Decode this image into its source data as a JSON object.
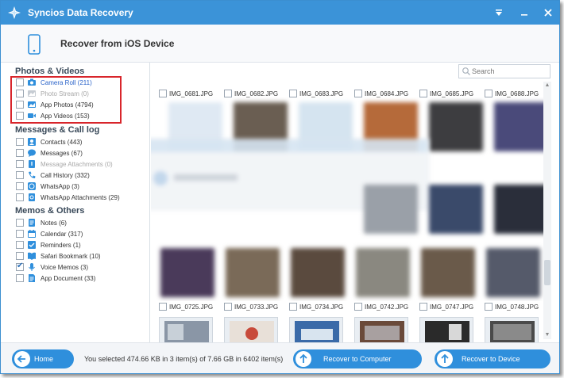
{
  "window": {
    "title": "Syncios Data Recovery",
    "controls": [
      "menu-icon",
      "minimize-icon",
      "close-icon"
    ]
  },
  "header": {
    "title": "Recover from iOS Device",
    "icon": "phone-icon"
  },
  "sidebar": {
    "sections": [
      {
        "title": "Photos & Videos",
        "items": [
          {
            "label": "Camera Roll (211)",
            "icon": "camera-icon",
            "state": "active",
            "checked": false
          },
          {
            "label": "Photo Stream (0)",
            "icon": "photo-stream-icon",
            "state": "disabled",
            "checked": false
          },
          {
            "label": "App Photos (4794)",
            "icon": "image-icon",
            "state": "normal",
            "checked": false
          },
          {
            "label": "App Videos (153)",
            "icon": "video-icon",
            "state": "normal",
            "checked": false
          }
        ]
      },
      {
        "title": "Messages & Call log",
        "items": [
          {
            "label": "Contacts (443)",
            "icon": "contacts-icon",
            "state": "normal",
            "checked": false
          },
          {
            "label": "Messages (67)",
            "icon": "messages-icon",
            "state": "normal",
            "checked": false
          },
          {
            "label": "Message Attachments (0)",
            "icon": "attachment-icon",
            "state": "disabled",
            "checked": false
          },
          {
            "label": "Call History (332)",
            "icon": "phone-call-icon",
            "state": "normal",
            "checked": false
          },
          {
            "label": "WhatsApp (3)",
            "icon": "whatsapp-icon",
            "state": "normal",
            "checked": false
          },
          {
            "label": "WhatsApp Attachments (29)",
            "icon": "whatsapp-attachment-icon",
            "state": "normal",
            "checked": false
          }
        ]
      },
      {
        "title": "Memos & Others",
        "items": [
          {
            "label": "Notes (6)",
            "icon": "notes-icon",
            "state": "normal",
            "checked": false
          },
          {
            "label": "Calendar (317)",
            "icon": "calendar-icon",
            "state": "normal",
            "checked": false
          },
          {
            "label": "Reminders (1)",
            "icon": "reminders-icon",
            "state": "normal",
            "checked": false
          },
          {
            "label": "Safari Bookmark (10)",
            "icon": "bookmark-icon",
            "state": "normal",
            "checked": false
          },
          {
            "label": "Voice Memos (3)",
            "icon": "microphone-icon",
            "state": "normal",
            "checked": true
          },
          {
            "label": "App Document (33)",
            "icon": "document-icon",
            "state": "normal",
            "checked": false
          }
        ]
      }
    ]
  },
  "search": {
    "placeholder": "Search"
  },
  "files_top": [
    "IMG_0681.JPG",
    "IMG_0682.JPG",
    "IMG_0683.JPG",
    "IMG_0684.JPG",
    "IMG_0685.JPG",
    "IMG_0688.JPG"
  ],
  "files_bottom": [
    "IMG_0725.JPG",
    "IMG_0733.JPG",
    "IMG_0734.JPG",
    "IMG_0742.JPG",
    "IMG_0747.JPG",
    "IMG_0748.JPG"
  ],
  "footer": {
    "home_label": "Home",
    "status": "You selected 474.66 KB in 3 item(s) of 7.66 GB in 6402 item(s)",
    "recover_computer_label": "Recover to Computer",
    "recover_device_label": "Recover to Device"
  },
  "colors": {
    "titlebar": "#3b93d8",
    "accent": "#2f8fdc",
    "active_item": "#2a63c9",
    "highlight_border": "#d8252b"
  }
}
